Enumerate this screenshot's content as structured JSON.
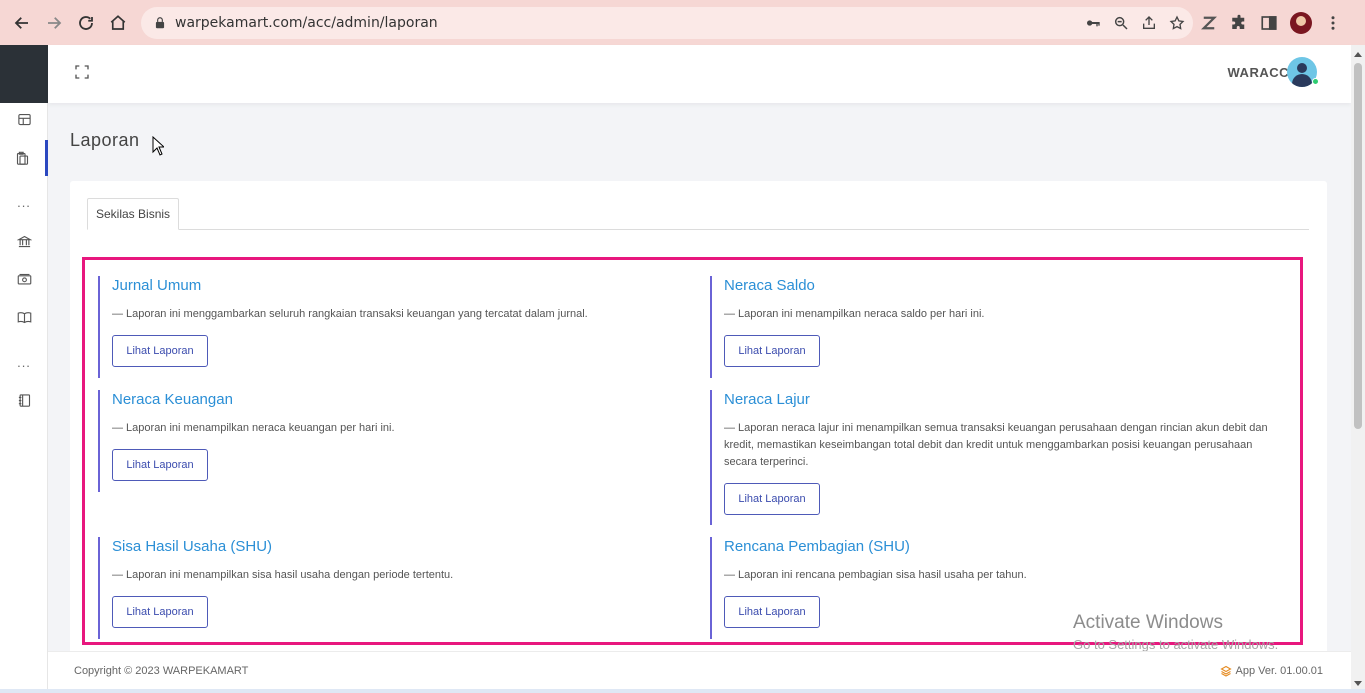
{
  "browser": {
    "url": "warpekamart.com/acc/admin/laporan"
  },
  "topbar": {
    "username": "WARACC"
  },
  "sidebar": {
    "dots_1": "...",
    "dots_2": "..."
  },
  "page": {
    "title": "Laporan"
  },
  "tabs": [
    {
      "label": "Sekilas Bisnis"
    }
  ],
  "reports": [
    {
      "title": "Jurnal Umum",
      "description": "— Laporan ini menggambarkan seluruh rangkaian transaksi keuangan yang tercatat dalam jurnal.",
      "button": "Lihat Laporan"
    },
    {
      "title": "Neraca Saldo",
      "description": "— Laporan ini menampilkan neraca saldo per hari ini.",
      "button": "Lihat Laporan"
    },
    {
      "title": "Neraca Keuangan",
      "description": "— Laporan ini menampilkan neraca keuangan per hari ini.",
      "button": "Lihat Laporan"
    },
    {
      "title": "Neraca Lajur",
      "description": "— Laporan neraca lajur ini menampilkan semua transaksi keuangan perusahaan dengan rincian akun debit dan kredit, memastikan keseimbangan total debit dan kredit untuk menggambarkan posisi keuangan perusahaan secara terperinci.",
      "button": "Lihat Laporan"
    },
    {
      "title": "Sisa Hasil Usaha (SHU)",
      "description": "— Laporan ini menampilkan sisa hasil usaha dengan periode tertentu.",
      "button": "Lihat Laporan"
    },
    {
      "title": "Rencana Pembagian (SHU)",
      "description": "— Laporan ini rencana pembagian sisa hasil usaha per tahun.",
      "button": "Lihat Laporan"
    }
  ],
  "watermark": {
    "line1": "Activate Windows",
    "line2": "Go to Settings to activate Windows."
  },
  "footer": {
    "copyright": "Copyright © 2023 WARPEKAMART",
    "version": "App Ver. 01.00.01"
  },
  "colors": {
    "accent": "#2b8fd6",
    "highlight": "#e8177e",
    "report_border": "#6a63d6",
    "button": "#4e5ab8",
    "sidebar_brand": "#2b3137",
    "chrome": "#f6d7d4"
  }
}
